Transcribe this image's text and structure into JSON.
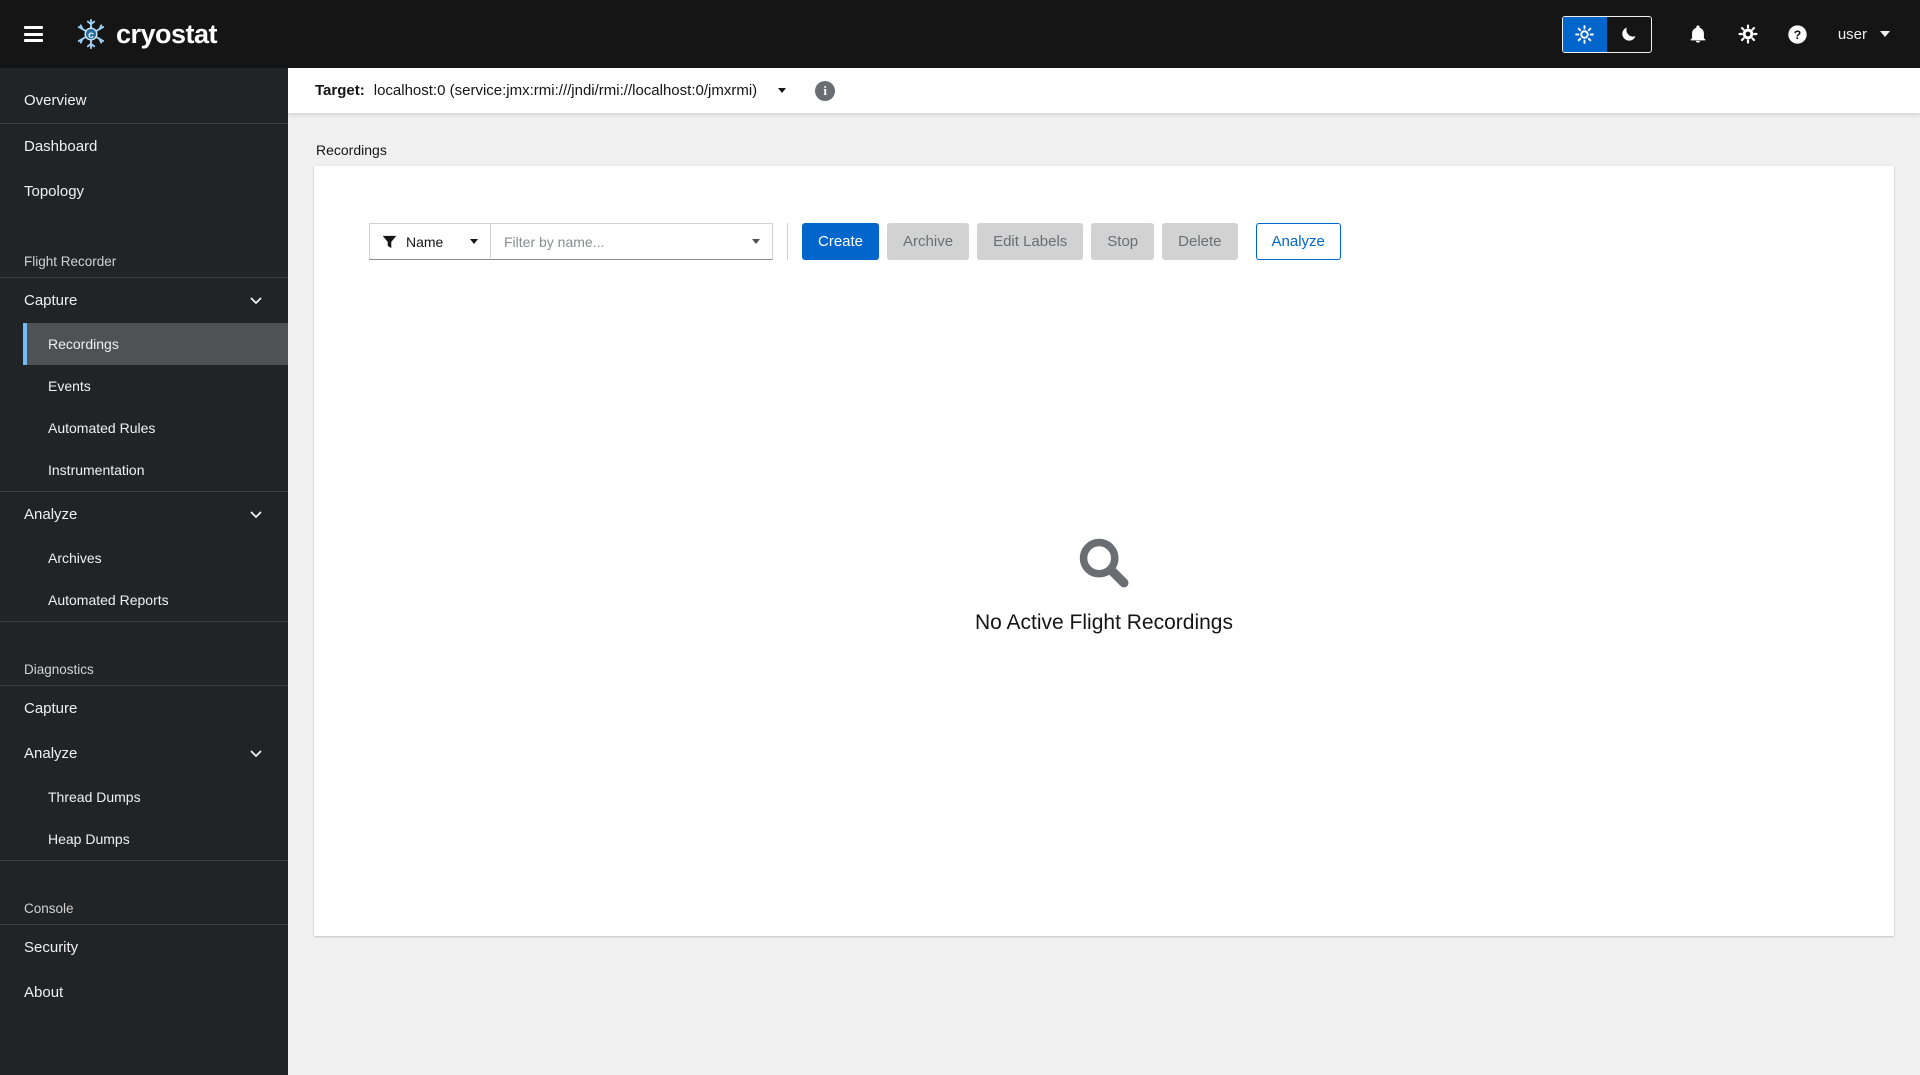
{
  "masthead": {
    "brand": "cryostat",
    "user_label": "user"
  },
  "sidebar": {
    "overview": "Overview",
    "dashboard": "Dashboard",
    "topology": "Topology",
    "flight_recorder_section": "Flight Recorder",
    "capture_group": "Capture",
    "recordings": "Recordings",
    "events": "Events",
    "automated_rules": "Automated Rules",
    "instrumentation": "Instrumentation",
    "analyze_group": "Analyze",
    "archives": "Archives",
    "automated_reports": "Automated Reports",
    "diagnostics_section": "Diagnostics",
    "capture_item": "Capture",
    "analyze_group_2": "Analyze",
    "thread_dumps": "Thread Dumps",
    "heap_dumps": "Heap Dumps",
    "console_section": "Console",
    "security": "Security",
    "about": "About"
  },
  "target_bar": {
    "label": "Target:",
    "value": "localhost:0 (service:jmx:rmi:///jndi/rmi://localhost:0/jmxrmi)"
  },
  "breadcrumb": {
    "current": "Recordings"
  },
  "recordings_toolbar": {
    "filter_category": "Name",
    "filter_placeholder": "Filter by name...",
    "create_label": "Create",
    "archive_label": "Archive",
    "edit_labels_label": "Edit Labels",
    "stop_label": "Stop",
    "delete_label": "Delete",
    "analyze_label": "Analyze"
  },
  "empty_state": {
    "title": "No Active Flight Recordings"
  },
  "colors": {
    "accent": "#0066cc",
    "masthead_bg": "#151515",
    "sidebar_bg": "#212427",
    "nav_current_bg": "#4f5255",
    "nav_current_indicator": "#73bcf7",
    "content_bg": "#f0f0f0",
    "disabled_bg": "#d2d2d2",
    "icon_gray": "#6a6e73"
  }
}
